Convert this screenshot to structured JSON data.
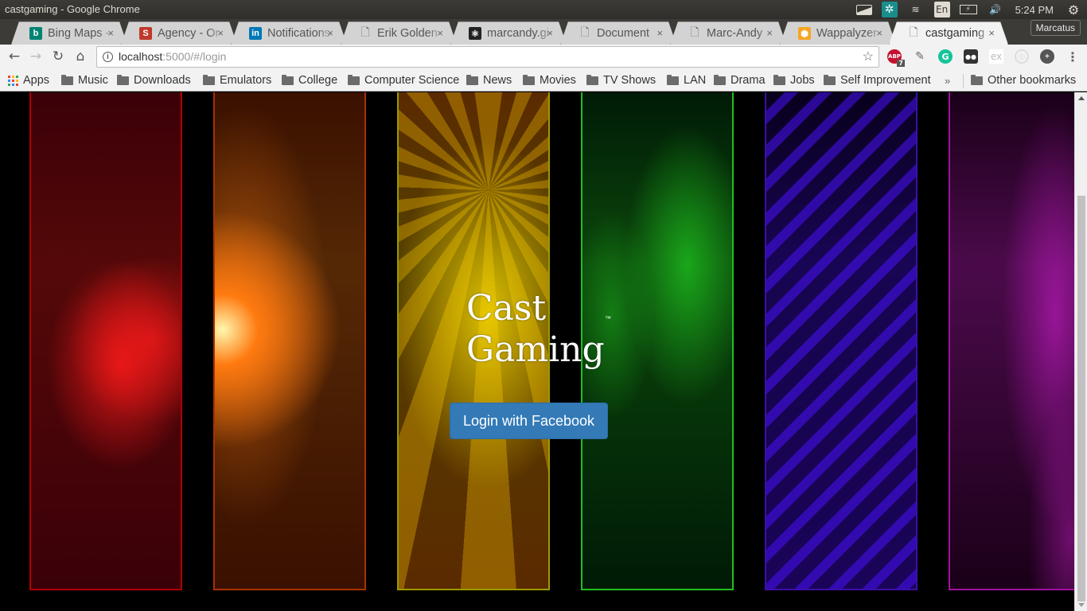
{
  "os": {
    "window_title": "castgaming - Google Chrome",
    "time": "5:24 PM",
    "language": "En"
  },
  "browser": {
    "profile_name": "Marcatus",
    "tabs": [
      {
        "label": "Bing Maps - ",
        "favicon": "bing-icon",
        "color": "#008373",
        "glyph": "b"
      },
      {
        "label": "Agency - Or",
        "favicon": "s-icon",
        "color": "#c0392b",
        "glyph": "S"
      },
      {
        "label": "Notifications",
        "favicon": "linkedin-icon",
        "color": "#0077b5",
        "glyph": "in"
      },
      {
        "label": "Erik Golden",
        "favicon": "page-icon",
        "color": "",
        "glyph": "🗋"
      },
      {
        "label": "marcandy.gi",
        "favicon": "react-icon",
        "color": "#222",
        "glyph": "⚛"
      },
      {
        "label": "Document",
        "favicon": "page-icon",
        "color": "",
        "glyph": "🗋"
      },
      {
        "label": "Marc-Andy",
        "favicon": "page-icon",
        "color": "",
        "glyph": "🗋"
      },
      {
        "label": "Wappalyzer",
        "favicon": "wappalyzer-icon",
        "color": "#f5a623",
        "glyph": "⬢"
      },
      {
        "label": "castgaming",
        "favicon": "page-icon",
        "color": "",
        "glyph": "🗋",
        "active": true
      }
    ],
    "address": {
      "host": "localhost",
      "rest": ":5000/#/login"
    },
    "extensions": [
      {
        "name": "adblock-plus-icon",
        "badge": "7"
      },
      {
        "name": "eyedropper-icon"
      },
      {
        "name": "grammarly-icon"
      },
      {
        "name": "tampermonkey-icon"
      },
      {
        "name": "ex-icon"
      },
      {
        "name": "circle-extension-icon"
      },
      {
        "name": "globe-extension-icon"
      }
    ],
    "bookmarks": [
      {
        "label": "Apps",
        "type": "apps"
      },
      {
        "label": "Music",
        "type": "folder"
      },
      {
        "label": "Downloads",
        "type": "folder"
      },
      {
        "label": "Emulators",
        "type": "folder"
      },
      {
        "label": "College",
        "type": "folder"
      },
      {
        "label": "Computer Science",
        "type": "folder"
      },
      {
        "label": "News",
        "type": "folder"
      },
      {
        "label": "Movies",
        "type": "folder"
      },
      {
        "label": "TV Shows",
        "type": "folder"
      },
      {
        "label": "LAN",
        "type": "folder"
      },
      {
        "label": "Drama",
        "type": "folder"
      },
      {
        "label": "Jobs",
        "type": "folder"
      },
      {
        "label": "Self Improvement",
        "type": "folder"
      }
    ],
    "bookmarks_overflow": "»",
    "other_bookmarks": "Other bookmarks"
  },
  "page": {
    "brand_line1": "Cast",
    "brand_line2": "Gaming",
    "trademark": "™",
    "login_button": "Login with Facebook",
    "panels": [
      {
        "name": "red",
        "border": "#b00000",
        "base": "#3a0008",
        "accent": "#ff1a1a"
      },
      {
        "name": "orange",
        "border": "#a83200",
        "base": "#3a1000",
        "accent": "#ff7a10"
      },
      {
        "name": "yellow",
        "border": "#9a9a00",
        "base": "#5a2a00",
        "accent": "#ffc400"
      },
      {
        "name": "green",
        "border": "#1fbf1f",
        "base": "#001a06",
        "accent": "#22d622"
      },
      {
        "name": "blue-violet",
        "border": "#3a10a8",
        "base": "#08001c",
        "accent": "#4a10ff"
      },
      {
        "name": "magenta",
        "border": "#a010a0",
        "base": "#1a0018",
        "accent": "#e020e0"
      }
    ],
    "primary_color": "#337ab7"
  }
}
